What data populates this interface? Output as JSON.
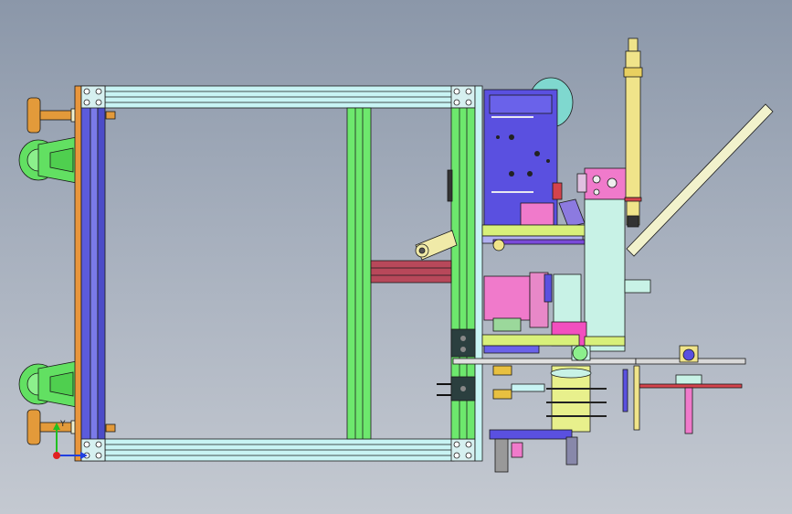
{
  "viewer": {
    "background_top": "#8b97a9",
    "background_bottom": "#c4c9d1"
  },
  "model": {
    "colors": {
      "profile_light": "#c8f4f4",
      "profile_green": "#6de86d",
      "plate_blue": "#5b5bdc",
      "plate_orange": "#e9963c",
      "wheel_orange": "#e39a3a",
      "caster_green": "#62e062",
      "motor_blue": "#5a50e0",
      "pink": "#f07acb",
      "magenta": "#f24fbf",
      "yellow_green": "#e8f08c",
      "yellow": "#f0e48a",
      "mint": "#c8f2e6",
      "red": "#d4434c",
      "dark": "#2b3f3f"
    }
  },
  "triad": {
    "axis_y_label": "Y",
    "axis_x_color": "#e02020",
    "axis_y_color": "#20c020",
    "axis_z_color": "#2040e0"
  }
}
